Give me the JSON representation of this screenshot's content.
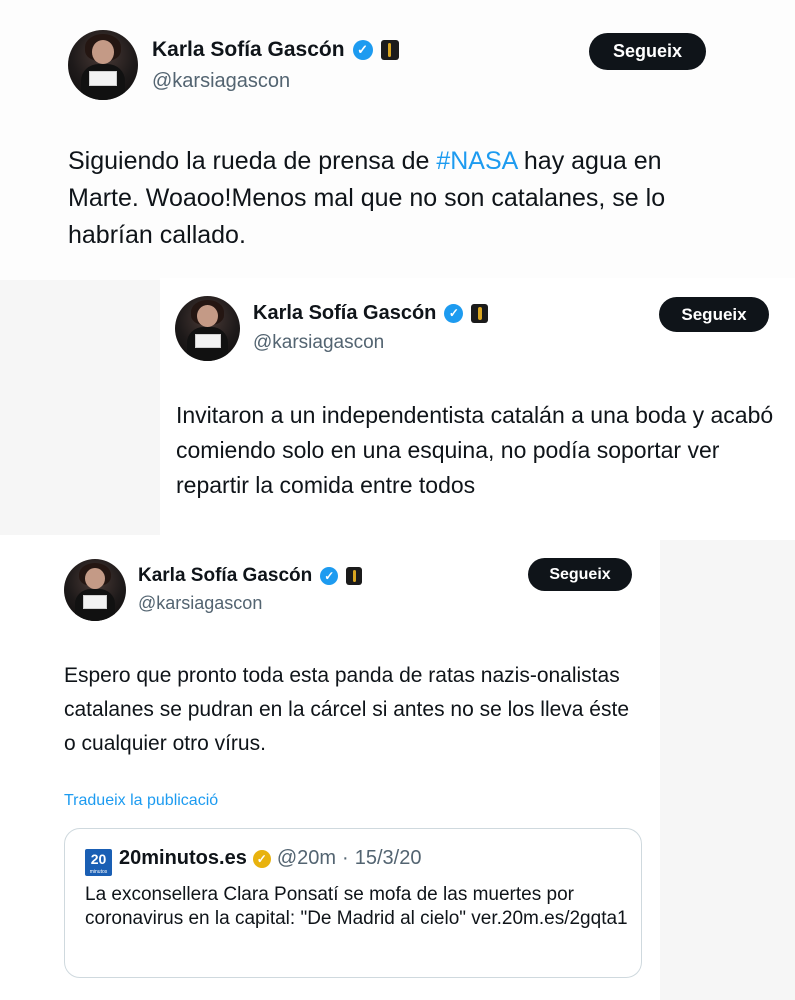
{
  "tweets": [
    {
      "name": "Karla Sofía Gascón",
      "handle": "@karsiagascon",
      "follow_label": "Segueix",
      "text_before": "Siguiendo la rueda de prensa de ",
      "hashtag": "#NASA",
      "text_after": " hay agua en Marte. Woaoo!Menos mal que no son catalanes, se lo habrían callado."
    },
    {
      "name": "Karla Sofía Gascón",
      "handle": "@karsiagascon",
      "follow_label": "Segueix",
      "text": "Invitaron a un independentista catalán a una boda y acabó comiendo solo en una esquina, no podía soportar ver repartir la comida entre todos"
    },
    {
      "name": "Karla Sofía Gascón",
      "handle": "@karsiagascon",
      "follow_label": "Segueix",
      "text": "Espero que pronto toda esta panda de ratas nazis-onalistas catalanes se pudran en la cárcel si antes no se los lleva éste o cualquier otro vírus.",
      "translate_label": "Tradueix la publicació",
      "quote": {
        "logo_number": "20",
        "logo_sub": "minutos",
        "name": "20minutos.es",
        "handle": "@20m",
        "separator": "·",
        "date": "15/3/20",
        "text": "La exconsellera Clara Ponsatí se mofa de las muertes por coronavirus en la capital: \"De Madrid al cielo\" ver.20m.es/2gqta1"
      }
    }
  ],
  "icons": {
    "verified": "verified-badge-icon",
    "award": "oscar-statuette-icon",
    "quote_verified": "gold-verified-badge-icon"
  },
  "colors": {
    "link": "#1d9bf0",
    "button_bg": "#0f1419",
    "verified_blue": "#1d9bf0",
    "verified_gold": "#e8b20e",
    "secondary_text": "#536471"
  }
}
